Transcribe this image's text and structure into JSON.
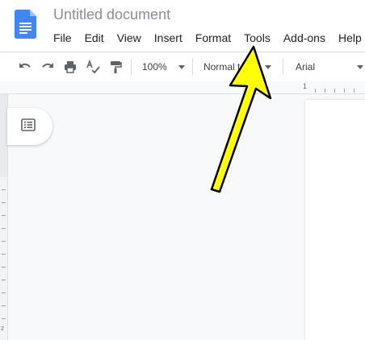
{
  "title": "Untitled document",
  "menu": [
    "File",
    "Edit",
    "View",
    "Insert",
    "Format",
    "Tools",
    "Add-ons",
    "Help"
  ],
  "toolbar": {
    "zoom": "100%",
    "style": "Normal text",
    "font": "Arial"
  },
  "ruler": {
    "number": "1"
  },
  "vertical_ruler": {
    "number": "2"
  },
  "icons": [
    "docs-logo-icon",
    "undo-icon",
    "redo-icon",
    "print-icon",
    "spellcheck-icon",
    "paint-format-icon",
    "outline-icon"
  ],
  "colors": {
    "docs_blue": "#4285f4",
    "arrow_yellow": "#ffff00",
    "canvas": "#f8f9fa"
  }
}
